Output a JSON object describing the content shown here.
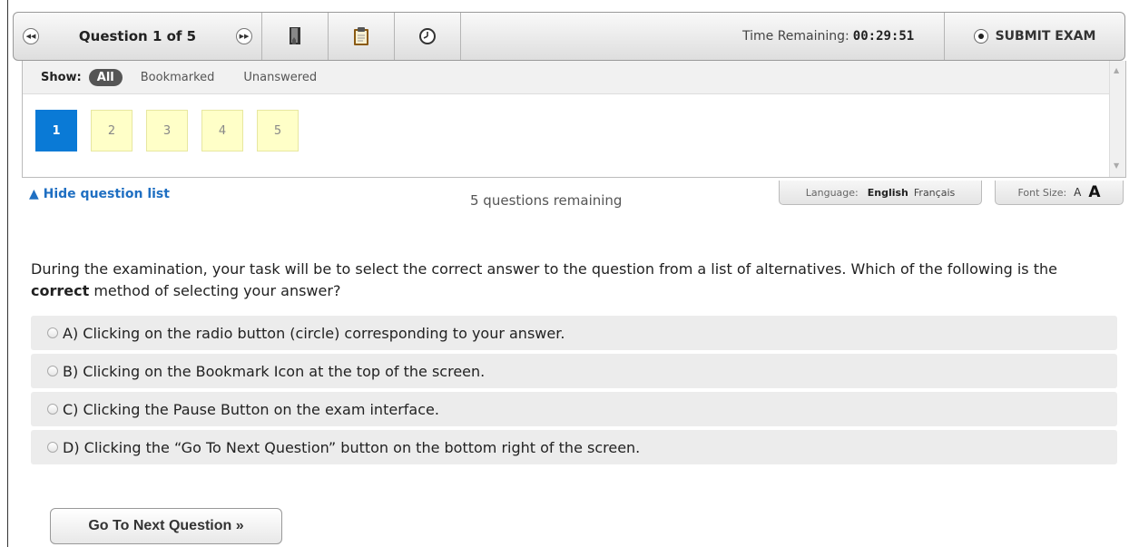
{
  "toolbar": {
    "question_title": "Question 1 of 5",
    "prev_icon": "rewind-icon",
    "next_icon": "fast-forward-icon",
    "bookmark_icon": "bookmark-icon",
    "clipboard_icon": "clipboard-icon",
    "timer_icon": "clock-icon",
    "time_label": "Time Remaining:",
    "time_value": "00:29:51",
    "submit_label": "SUBMIT EXAM"
  },
  "question_list": {
    "show_label": "Show:",
    "filters": [
      "All",
      "Bookmarked",
      "Unanswered"
    ],
    "active_filter": "All",
    "numbers": [
      "1",
      "2",
      "3",
      "4",
      "5"
    ],
    "current": "1"
  },
  "hide_list_label": "▲ Hide question list",
  "remaining_text": "5 questions remaining",
  "language": {
    "label": "Language:",
    "english": "English",
    "french": "Français"
  },
  "font_size": {
    "label": "Font Size:",
    "small": "A",
    "large": "A"
  },
  "question": {
    "text_before": "During the examination, your task will be to select the correct answer to the question from a list of alternatives. Which of the following is the ",
    "emphasis": "correct",
    "text_after": " method of selecting your answer?",
    "options": [
      "A) Clicking on the radio button (circle) corresponding to your answer.",
      "B) Clicking on the Bookmark Icon at the top of the screen.",
      "C) Clicking the Pause Button on the exam interface.",
      "D) Clicking the “Go To Next Question” button on the bottom right of the screen."
    ]
  },
  "next_button_label": "Go To Next Question »",
  "colors": {
    "accent": "#0a7ad6",
    "unanswered": "#ffffc8",
    "link": "#1f6fc2"
  }
}
